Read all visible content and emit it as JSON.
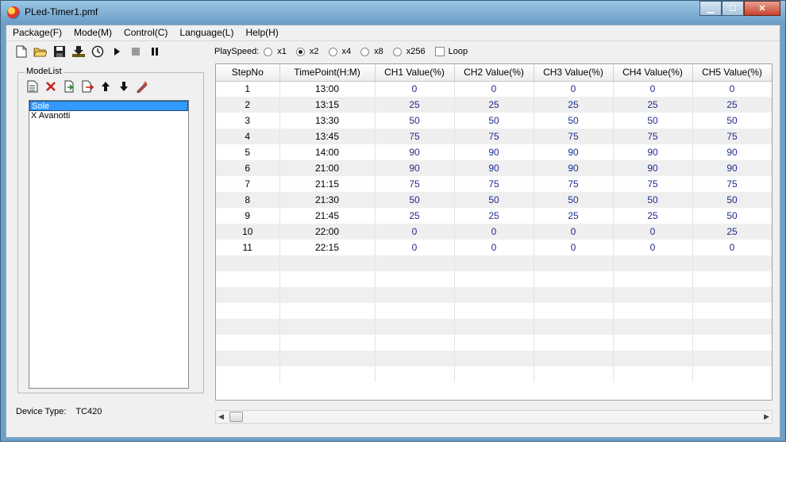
{
  "window": {
    "title": "PLed-Timer1.pmf",
    "minimize": "▁",
    "maximize": "☐",
    "close": "✕"
  },
  "menu": [
    "Package(F)",
    "Mode(M)",
    "Control(C)",
    "Language(L)",
    "Help(H)"
  ],
  "toolbar": {
    "icons": [
      "new-file-icon",
      "open-folder-icon",
      "save-icon",
      "download-icon",
      "clock-icon",
      "play-icon",
      "stop-icon",
      "pause-icon"
    ]
  },
  "playspeed": {
    "label": "PlaySpeed:",
    "options": [
      "x1",
      "x2",
      "x4",
      "x8",
      "x256"
    ],
    "selected": "x2",
    "loop_label": "Loop",
    "loop_checked": false
  },
  "modelist": {
    "title": "ModeList",
    "tool_icons": [
      "new-mode-icon",
      "delete-icon",
      "import-icon",
      "export-icon",
      "move-up-icon",
      "move-down-icon",
      "edit-icon"
    ],
    "items": [
      "Sole",
      "X Avanotti"
    ],
    "selected_index": 0
  },
  "device": {
    "label": "Device Type:",
    "value": "TC420"
  },
  "table": {
    "columns": [
      "StepNo",
      "TimePoint(H:M)",
      "CH1 Value(%)",
      "CH2 Value(%)",
      "CH3 Value(%)",
      "CH4 Value(%)",
      "CH5 Value(%)"
    ],
    "rows": [
      [
        "1",
        "13:00",
        "0",
        "0",
        "0",
        "0",
        "0"
      ],
      [
        "2",
        "13:15",
        "25",
        "25",
        "25",
        "25",
        "25"
      ],
      [
        "3",
        "13:30",
        "50",
        "50",
        "50",
        "50",
        "50"
      ],
      [
        "4",
        "13:45",
        "75",
        "75",
        "75",
        "75",
        "75"
      ],
      [
        "5",
        "14:00",
        "90",
        "90",
        "90",
        "90",
        "90"
      ],
      [
        "6",
        "21:00",
        "90",
        "90",
        "90",
        "90",
        "90"
      ],
      [
        "7",
        "21:15",
        "75",
        "75",
        "75",
        "75",
        "75"
      ],
      [
        "8",
        "21:30",
        "50",
        "50",
        "50",
        "50",
        "50"
      ],
      [
        "9",
        "21:45",
        "25",
        "25",
        "25",
        "25",
        "50"
      ],
      [
        "10",
        "22:00",
        "0",
        "0",
        "0",
        "0",
        "25"
      ],
      [
        "11",
        "22:15",
        "0",
        "0",
        "0",
        "0",
        "0"
      ]
    ],
    "empty_rows": 8
  },
  "colors": {
    "selection": "#3399ff",
    "value_text": "#1d2c8a"
  }
}
